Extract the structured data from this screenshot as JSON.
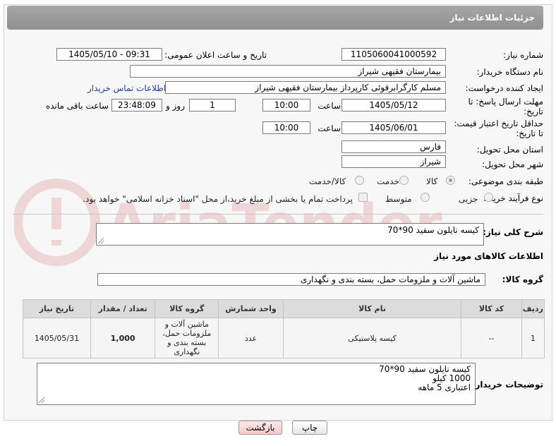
{
  "header": {
    "title": "جزئیات اطلاعات نیاز"
  },
  "labels": {
    "need_number": "شماره نیاز:",
    "announce_datetime": "تاریخ و ساعت اعلان عمومی:",
    "buyer_org": "نام دستگاه خریدار:",
    "requester": "ایجاد کننده درخواست:",
    "contact_link": "اطلاعات تماس خریدار",
    "reply_deadline": "مهلت ارسال پاسخ: تا تاریخ:",
    "time": "ساعت",
    "day_and": "روز و",
    "remaining": "ساعت باقی مانده",
    "price_validity": "حداقل تاریخ اعتبار قیمت: تا تاریخ:",
    "delivery_province": "استان محل تحویل:",
    "delivery_city": "شهر محل تحویل:",
    "category": "طبقه بندی موضوعی:",
    "purchase_type": "نوع فرآیند خرید :",
    "general_desc": "شرح کلی نیاز:",
    "goods_info": "اطلاعات کالاهای مورد نیاز",
    "goods_group": "گروه کالا:",
    "buyer_notes": "توضیحات خریدار:"
  },
  "values": {
    "need_number": "1105060041000592",
    "announce_datetime": "1405/05/10 - 09:31",
    "buyer_org": "بیمارستان فقیهی شیراز",
    "requester": "مسلم کارگرابرقوئی کارپرداز  بیمارستان فقیهی شیراز",
    "reply_date": "1405/05/12",
    "reply_time": "10:00",
    "reply_days": "1",
    "reply_remaining": "23:48:09",
    "price_date": "1405/06/01",
    "price_time": "10:00",
    "province": "فارس",
    "city": "شیراز",
    "general_desc": "کیسه نایلون سفید 90*70",
    "goods_group": "ماشین آلات و ملزومات حمل، بسته بندی و نگهداری",
    "buyer_notes_1": "کیسه نایلون سفید 90*70",
    "buyer_notes_2": "1000 کیلو",
    "buyer_notes_3": "اعتباری 5 ماهه"
  },
  "category_options": [
    {
      "label": "کالا",
      "selected": true
    },
    {
      "label": "خدمت",
      "selected": false
    },
    {
      "label": "کالا/خدمت",
      "selected": false
    }
  ],
  "purchase_options": [
    {
      "label": "جزیی",
      "selected": false
    },
    {
      "label": "متوسط",
      "selected": false
    }
  ],
  "payment_note": "پرداخت تمام یا بخشی از مبلغ خرید،از محل \"اسناد خزانه اسلامی\" خواهد بود.",
  "table": {
    "headers": [
      "ردیف",
      "کد کالا",
      "نام کالا",
      "واحد شمارش",
      "گروه کالا",
      "تعداد / مقدار",
      "تاریخ نیاز"
    ],
    "rows": [
      [
        "1",
        "--",
        "کیسه پلاستیکی",
        "عدد",
        "ماشین آلات و ملزومات حمل، بسته بندی و نگهداری",
        "1,000",
        "1405/05/31"
      ]
    ]
  },
  "buttons": {
    "print": "چاپ",
    "back": "بازگشت"
  },
  "watermark": "AriaTender.neT"
}
